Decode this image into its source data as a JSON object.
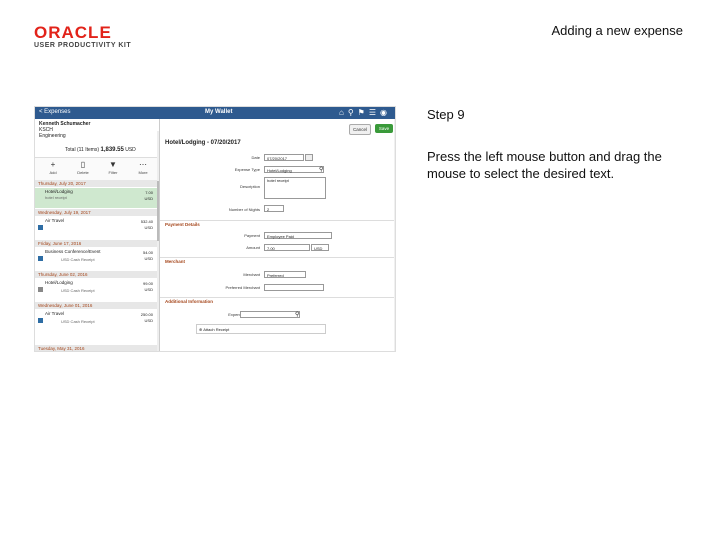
{
  "logo": {
    "main": "ORACLE",
    "sub": "USER PRODUCTIVITY KIT"
  },
  "doc_title": "Adding a new expense",
  "step": {
    "label": "Step 9",
    "text": "Press the left mouse button and drag the mouse to select the desired text."
  },
  "screenshot": {
    "topbar": {
      "back": "< Expenses",
      "title": "My Wallet"
    },
    "employee": {
      "name": "Kenneth Schumacher",
      "id": "KSCH",
      "dept": "Engineering"
    },
    "total": {
      "label": "Total (11 Items)",
      "amount": "1,839.55",
      "currency": "USD"
    },
    "toolbar": [
      "Add",
      "Delete",
      "Filter",
      "More"
    ],
    "days": [
      {
        "header": "Thursday, July 20, 2017",
        "entries": [
          {
            "title": "Hotel/Lodging",
            "sub": "hotel receipt",
            "amount": "7.00",
            "currency": "USD",
            "selected": true
          }
        ]
      },
      {
        "header": "Wednesday, July 19, 2017",
        "entries": [
          {
            "title": "Air Travel",
            "sub": "",
            "amount": "532.40",
            "currency": "USD"
          }
        ]
      },
      {
        "header": "Friday, June 17, 2016",
        "entries": [
          {
            "title": "Business Conference/Event",
            "sub": "USD Cash Receipt",
            "amount": "54.00",
            "currency": "USD"
          }
        ]
      },
      {
        "header": "Thursday, June 02, 2016",
        "entries": [
          {
            "title": "Hotel/Lodging",
            "sub": "USD Cash Receipt",
            "amount": "99.00",
            "currency": "USD"
          }
        ]
      },
      {
        "header": "Wednesday, June 01, 2016",
        "entries": [
          {
            "title": "Air Travel",
            "sub": "USD Cash Receipt",
            "amount": "250.00",
            "currency": "USD"
          }
        ]
      },
      {
        "header": "Tuesday, May 31, 2016",
        "entries": []
      }
    ],
    "detail": {
      "cancel": "Cancel",
      "save": "Save",
      "title": "Hotel/Lodging - 07/20/2017",
      "fields": [
        {
          "label": "Date",
          "value": "07/20/2017"
        },
        {
          "label": "Expense Type",
          "value": "Hotel/Lodging"
        },
        {
          "label": "Description",
          "value": "hotel receipt"
        },
        {
          "label": "Number of Nights",
          "value": "2"
        }
      ],
      "payment_section": "Payment Details",
      "payment": [
        {
          "label": "Payment",
          "value": "Employee Paid"
        },
        {
          "label": "Amount",
          "value": "7.00",
          "currency": "USD"
        }
      ],
      "merchant_section": "Merchant",
      "merchant": [
        {
          "label": "Merchant",
          "value": "Preferred"
        },
        {
          "label": "Preferred Merchant",
          "value": ""
        }
      ],
      "location_section": "Additional Information",
      "location": {
        "label": "Expense Location",
        "value": ""
      },
      "attach": "Attach Receipt"
    }
  }
}
